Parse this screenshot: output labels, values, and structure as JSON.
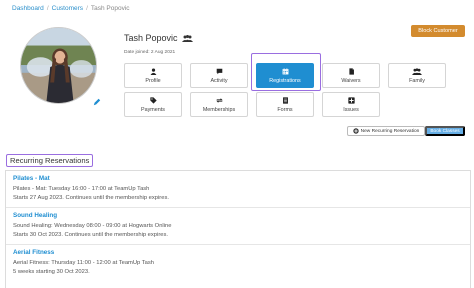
{
  "breadcrumb": {
    "items": [
      "Dashboard",
      "Customers",
      "Tash Popovic"
    ]
  },
  "customer": {
    "name": "Tash Popovic",
    "date_joined": "Date joined: 2 Aug 2021"
  },
  "actions": {
    "block_label": "Block Customer",
    "new_reservation_label": "New Recurring Reservation",
    "book_classes_label": "Book Classes"
  },
  "tiles": [
    {
      "label": "Profile",
      "icon": "user-icon"
    },
    {
      "label": "Activity",
      "icon": "chat-icon"
    },
    {
      "label": "Registrations",
      "icon": "calendar-icon",
      "active": true
    },
    {
      "label": "Waivers",
      "icon": "document-icon"
    },
    {
      "label": "Family",
      "icon": "users-icon"
    },
    {
      "label": "Payments",
      "icon": "tag-icon"
    },
    {
      "label": "Memberships",
      "icon": "refresh-icon"
    },
    {
      "label": "Forms",
      "icon": "list-icon"
    },
    {
      "label": "Issues",
      "icon": "plus-square-icon"
    }
  ],
  "recurring": {
    "title": "Recurring Reservations",
    "items": [
      {
        "name": "Pilates - Mat",
        "line1": "Pilates - Mat: Tuesday 16:00 - 17:00 at TeamUp Tash",
        "line2": "Starts 27 Aug 2023. Continues until the membership expires."
      },
      {
        "name": "Sound Healing",
        "line1": "Sound Healing: Wednesday 08:00 - 09:00 at Hogwarts Online",
        "line2": "Starts 30 Oct 2023. Continues until the membership expires."
      },
      {
        "name": "Aerial Fitness",
        "line1": "Aerial Fitness: Thursday 11:00 - 12:00 at TeamUp Tash",
        "line2": "5 weeks starting 30 Oct 2023."
      }
    ]
  },
  "colors": {
    "accent": "#1f8ed1",
    "block_button": "#d38b2e",
    "book_button": "#66aee5",
    "highlight": "#9a6ee0"
  }
}
